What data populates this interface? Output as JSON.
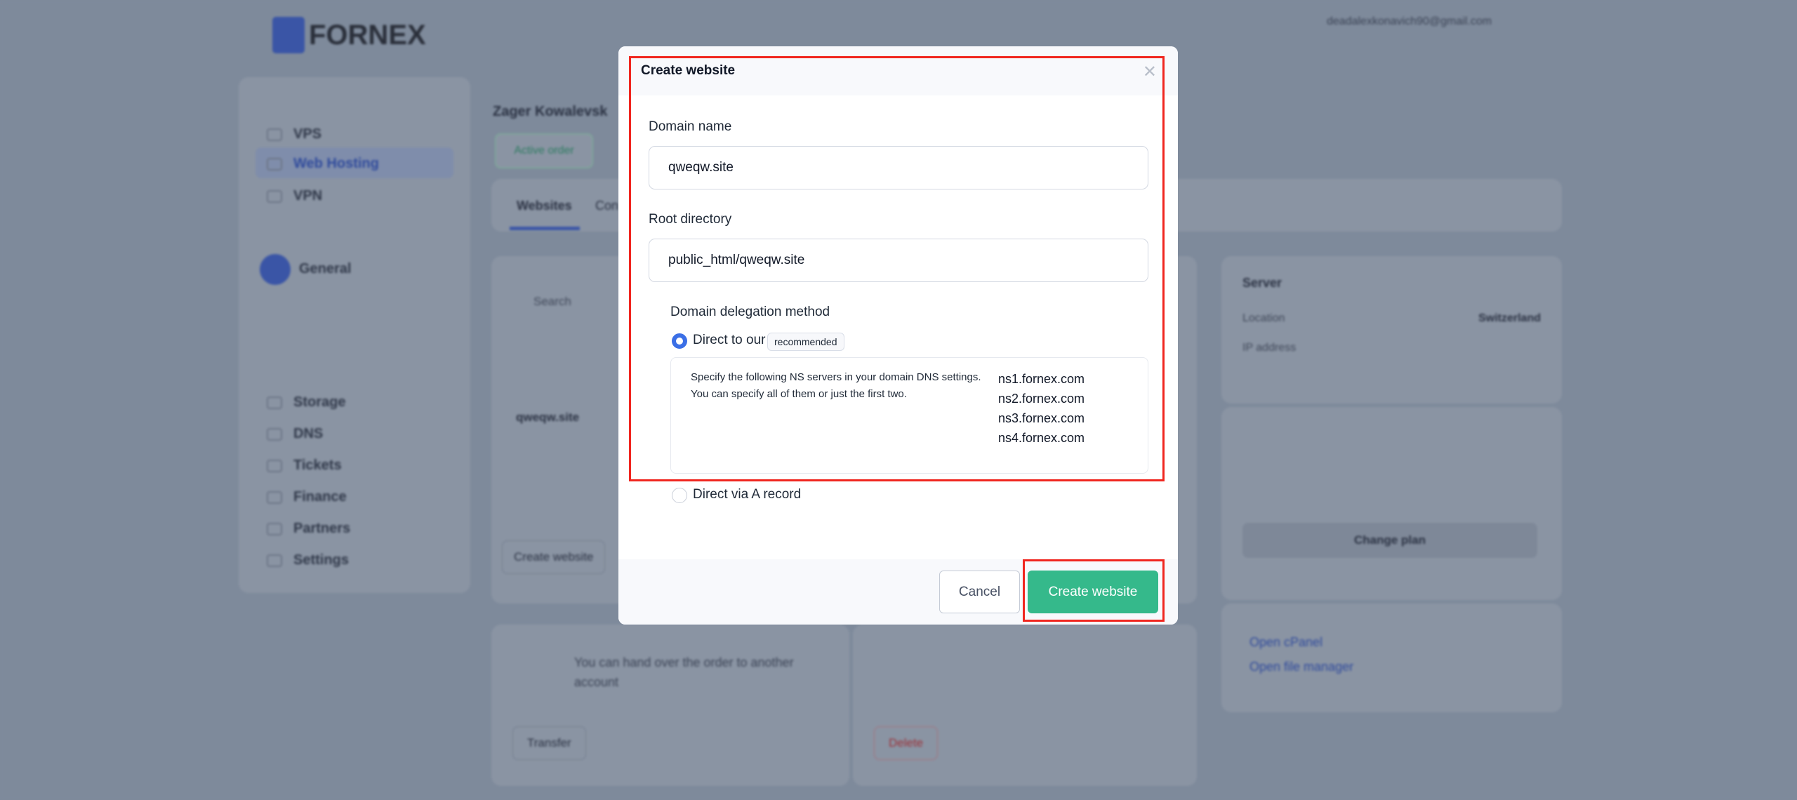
{
  "background": {
    "logo": "FORNEX",
    "user_email": "deadalexkonavich90@gmail.com",
    "sidebar": {
      "services": [
        "VPS",
        "Web Hosting",
        "VPN"
      ],
      "project": "General",
      "other": [
        "Storage",
        "DNS",
        "Tickets",
        "Finance",
        "Partners",
        "Settings"
      ]
    },
    "order": {
      "title": "Zager Kowalevsk",
      "status": "Active order"
    },
    "tabs": [
      "Websites",
      "Con"
    ],
    "websites": {
      "search_placeholder": "Search",
      "site": "qweqw.site",
      "create_button": "Create website"
    },
    "server": {
      "title": "Server",
      "location_label": "Location",
      "location_value": "Switzerland",
      "ip_label": "IP address"
    },
    "plan": {
      "button": "Change plan"
    },
    "links": [
      "Open cPanel",
      "Open file manager"
    ],
    "transfer": {
      "text": "You can hand over the order to another account",
      "button": "Transfer"
    },
    "delete": {
      "button": "Delete"
    }
  },
  "modal": {
    "title": "Create website",
    "close_icon": "close-icon",
    "domain_label": "Domain name",
    "domain_value": "qweqw.site",
    "root_label": "Root directory",
    "root_value": "public_html/qweqw.site",
    "delegation_label": "Domain delegation method",
    "options": [
      {
        "label": "Direct to our NS servers",
        "badge": "recommended",
        "selected": true
      },
      {
        "label": "Direct via A record",
        "selected": false
      }
    ],
    "ns_info": "Specify the following NS servers in your domain DNS settings. You can specify all of them or just the first two.",
    "ns_servers": [
      "ns1.fornex.com",
      "ns2.fornex.com",
      "ns3.fornex.com",
      "ns4.fornex.com"
    ],
    "cancel": "Cancel",
    "submit": "Create website"
  },
  "colors": {
    "accent": "#3b6fe6",
    "primary_button": "#35b98b",
    "highlight": "#f0261f"
  }
}
